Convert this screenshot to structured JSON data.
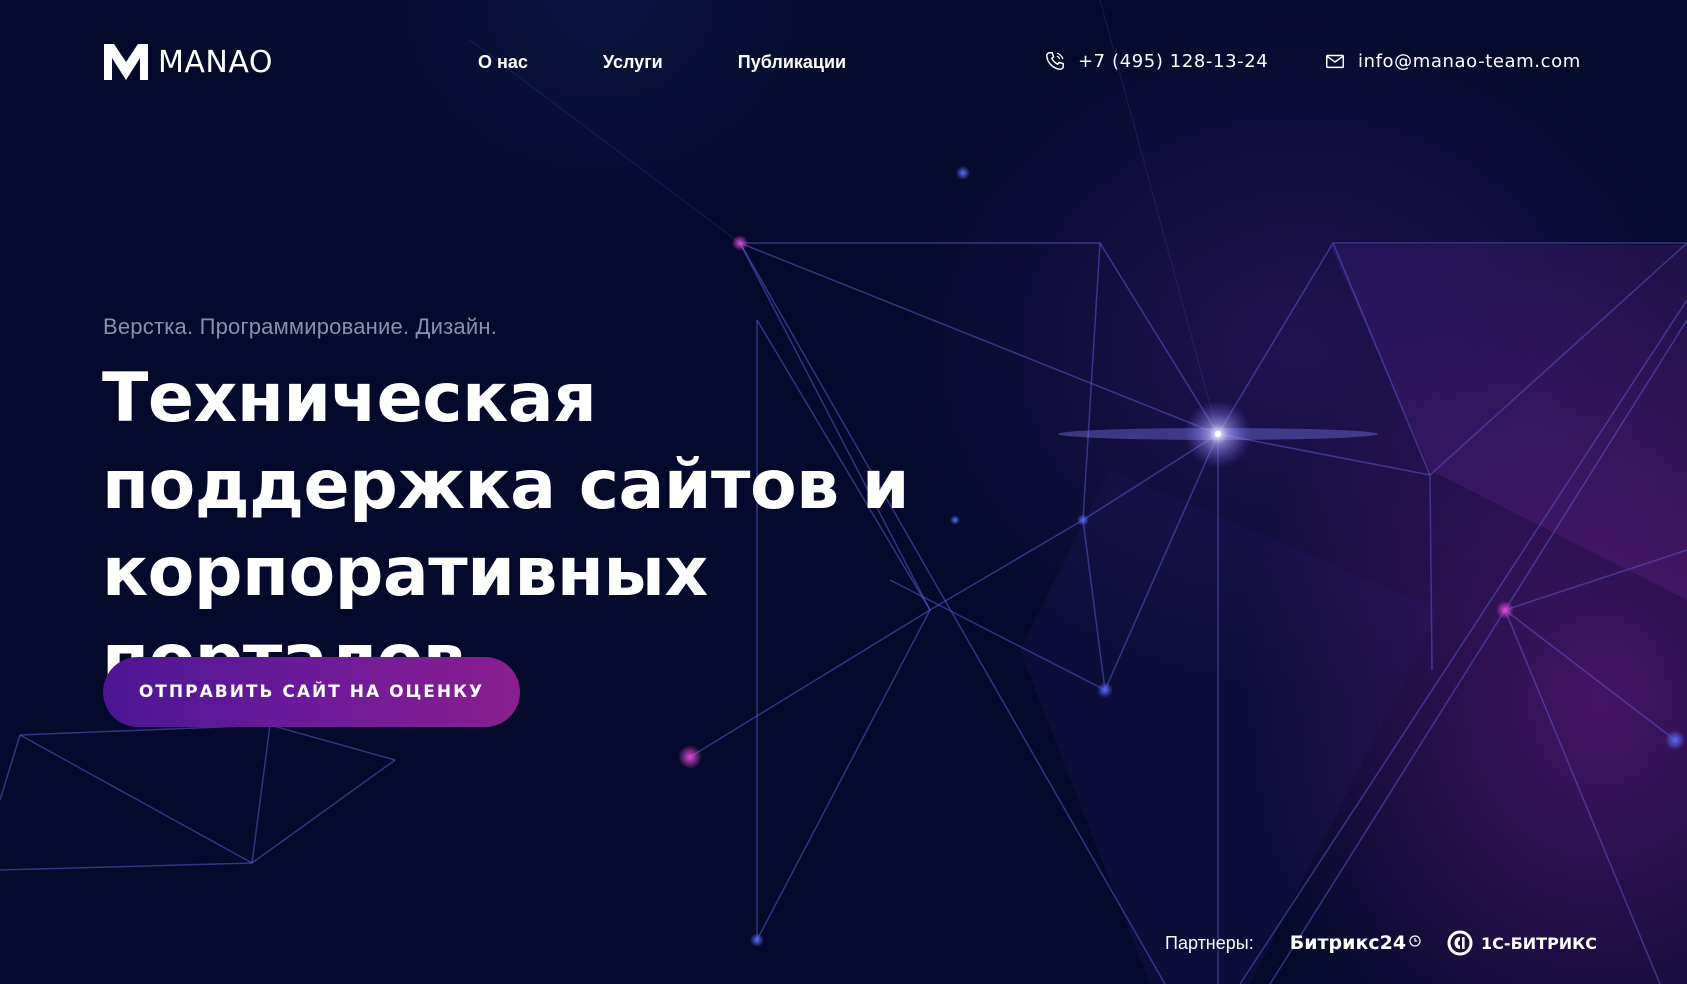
{
  "header": {
    "logo_text": "MANAO",
    "nav": [
      {
        "label": "О нас"
      },
      {
        "label": "Услуги"
      },
      {
        "label": "Публикации"
      }
    ],
    "phone": "+7 (495) 128-13-24",
    "email": "info@manao-team.com"
  },
  "hero": {
    "tagline": "Верстка. Программирование. Дизайн.",
    "headline": "Техническая поддержка сайтов и корпоративных порталов",
    "cta_label": "ОТПРАВИТЬ САЙТ НА ОЦЕНКУ"
  },
  "partners": {
    "label": "Партнеры:",
    "items": [
      {
        "name": "Битрикс24"
      },
      {
        "name": "1С-БИТРИКС"
      }
    ]
  },
  "colors": {
    "background": "#050a2c",
    "accent_start": "#4b1694",
    "accent_end": "#8a1e8e",
    "tagline": "#8a8fb2"
  },
  "icons": [
    "manao-logo-icon",
    "phone-icon",
    "mail-icon",
    "bitrix24-clock-icon",
    "1c-bitrix-icon"
  ]
}
